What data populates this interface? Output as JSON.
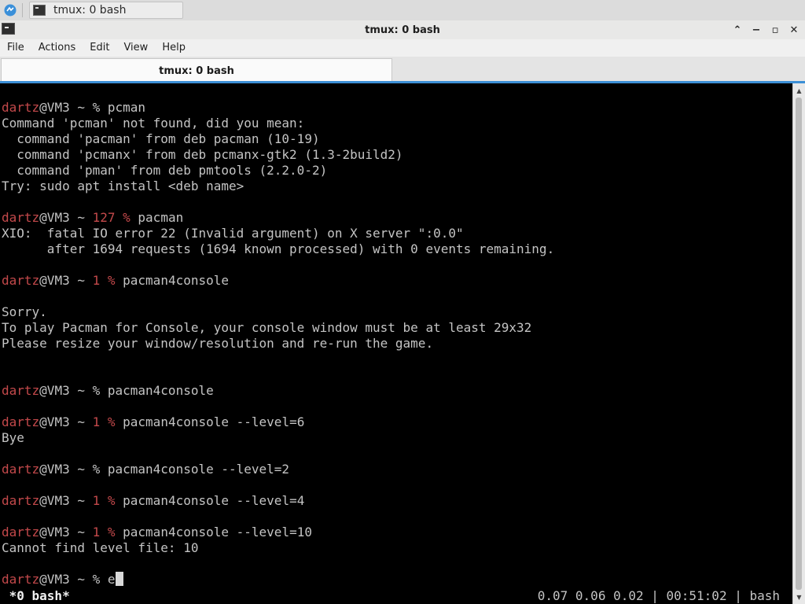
{
  "taskbar": {
    "task_title": "tmux: 0 bash",
    "start_icon": "app-menu-icon",
    "task_icon": "terminal-icon"
  },
  "window": {
    "title": "tmux: 0 bash",
    "icon": "terminal-icon",
    "buttons": {
      "minimize": "−",
      "maximize": "▫",
      "close": "✕",
      "shade": "⌃"
    }
  },
  "menubar": {
    "items": [
      "File",
      "Actions",
      "Edit",
      "View",
      "Help"
    ]
  },
  "tabs": [
    {
      "label": "tmux: 0 bash",
      "active": true
    }
  ],
  "terminal": {
    "lines": [
      {
        "segs": [
          {
            "t": "dartz",
            "c": "red"
          },
          {
            "t": "@VM3 ~ % pcman"
          }
        ]
      },
      {
        "segs": [
          {
            "t": "Command 'pcman' not found, did you mean:"
          }
        ]
      },
      {
        "segs": [
          {
            "t": "  command 'pacman' from deb pacman (10-19)"
          }
        ]
      },
      {
        "segs": [
          {
            "t": "  command 'pcmanx' from deb pcmanx-gtk2 (1.3-2build2)"
          }
        ]
      },
      {
        "segs": [
          {
            "t": "  command 'pman' from deb pmtools (2.2.0-2)"
          }
        ]
      },
      {
        "segs": [
          {
            "t": "Try: sudo apt install <deb name>"
          }
        ]
      },
      {
        "segs": [
          {
            "t": ""
          }
        ]
      },
      {
        "segs": [
          {
            "t": "dartz",
            "c": "red"
          },
          {
            "t": "@VM3 ~ "
          },
          {
            "t": "127 %",
            "c": "red"
          },
          {
            "t": " pacman"
          }
        ]
      },
      {
        "segs": [
          {
            "t": "XIO:  fatal IO error 22 (Invalid argument) on X server \":0.0\""
          }
        ]
      },
      {
        "segs": [
          {
            "t": "      after 1694 requests (1694 known processed) with 0 events remaining."
          }
        ]
      },
      {
        "segs": [
          {
            "t": ""
          }
        ]
      },
      {
        "segs": [
          {
            "t": "dartz",
            "c": "red"
          },
          {
            "t": "@VM3 ~ "
          },
          {
            "t": "1 %",
            "c": "red"
          },
          {
            "t": " pacman4console"
          }
        ]
      },
      {
        "segs": [
          {
            "t": ""
          }
        ]
      },
      {
        "segs": [
          {
            "t": "Sorry."
          }
        ]
      },
      {
        "segs": [
          {
            "t": "To play Pacman for Console, your console window must be at least 29x32"
          }
        ]
      },
      {
        "segs": [
          {
            "t": "Please resize your window/resolution and re-run the game."
          }
        ]
      },
      {
        "segs": [
          {
            "t": ""
          }
        ]
      },
      {
        "segs": [
          {
            "t": ""
          }
        ]
      },
      {
        "segs": [
          {
            "t": "dartz",
            "c": "red"
          },
          {
            "t": "@VM3 ~ % pacman4console"
          }
        ]
      },
      {
        "segs": [
          {
            "t": ""
          }
        ]
      },
      {
        "segs": [
          {
            "t": "dartz",
            "c": "red"
          },
          {
            "t": "@VM3 ~ "
          },
          {
            "t": "1 %",
            "c": "red"
          },
          {
            "t": " pacman4console --level=6"
          }
        ]
      },
      {
        "segs": [
          {
            "t": "Bye"
          }
        ]
      },
      {
        "segs": [
          {
            "t": ""
          }
        ]
      },
      {
        "segs": [
          {
            "t": "dartz",
            "c": "red"
          },
          {
            "t": "@VM3 ~ % pacman4console --level=2"
          }
        ]
      },
      {
        "segs": [
          {
            "t": ""
          }
        ]
      },
      {
        "segs": [
          {
            "t": "dartz",
            "c": "red"
          },
          {
            "t": "@VM3 ~ "
          },
          {
            "t": "1 %",
            "c": "red"
          },
          {
            "t": " pacman4console --level=4"
          }
        ]
      },
      {
        "segs": [
          {
            "t": ""
          }
        ]
      },
      {
        "segs": [
          {
            "t": "dartz",
            "c": "red"
          },
          {
            "t": "@VM3 ~ "
          },
          {
            "t": "1 %",
            "c": "red"
          },
          {
            "t": " pacman4console --level=10"
          }
        ]
      },
      {
        "segs": [
          {
            "t": "Cannot find level file: 10"
          }
        ]
      },
      {
        "segs": [
          {
            "t": ""
          }
        ]
      },
      {
        "segs": [
          {
            "t": "dartz",
            "c": "red"
          },
          {
            "t": "@VM3 ~ % e"
          }
        ],
        "cursor": true
      }
    ],
    "status_left": " *0 bash*",
    "status_right": "0.07 0.06 0.02 | 00:51:02 | bash"
  },
  "colors": {
    "terminal_bg": "#000000",
    "terminal_fg": "#c4c4c4",
    "prompt_red": "#c4494b",
    "tab_accent": "#3c8fd6"
  }
}
